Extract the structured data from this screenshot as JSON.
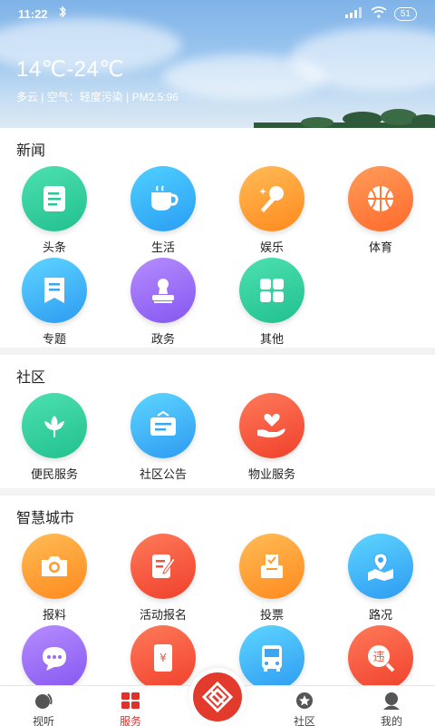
{
  "status": {
    "time": "11:22",
    "battery": "51"
  },
  "weather": {
    "temp": "14℃-24℃",
    "line": "多云 | 空气：轻度污染 | PM2.5:96"
  },
  "sections": {
    "news": {
      "title": "新闻",
      "items": [
        {
          "label": "头条",
          "icon": "document-icon",
          "color_from": "#4de0b0",
          "color_to": "#22c08f"
        },
        {
          "label": "生活",
          "icon": "coffee-cup-icon",
          "color_from": "#4fd0ff",
          "color_to": "#2a9ef4"
        },
        {
          "label": "娱乐",
          "icon": "microphone-icon",
          "color_from": "#ffbb55",
          "color_to": "#ff8a1e"
        },
        {
          "label": "体育",
          "icon": "basketball-icon",
          "color_from": "#ff9c5a",
          "color_to": "#ff6a2b"
        },
        {
          "label": "专题",
          "icon": "bookmark-doc-icon",
          "color_from": "#5ed5ff",
          "color_to": "#2d9bf2"
        },
        {
          "label": "政务",
          "icon": "stamp-icon",
          "color_from": "#b68cff",
          "color_to": "#8557f0"
        },
        {
          "label": "其他",
          "icon": "grid-apps-icon",
          "color_from": "#4de0b0",
          "color_to": "#22c08f"
        }
      ]
    },
    "community": {
      "title": "社区",
      "items": [
        {
          "label": "便民服务",
          "icon": "lotus-icon",
          "color_from": "#4de0b0",
          "color_to": "#22c08f"
        },
        {
          "label": "社区公告",
          "icon": "notice-board-icon",
          "color_from": "#5ed5ff",
          "color_to": "#2d9bf2"
        },
        {
          "label": "物业服务",
          "icon": "heart-hand-icon",
          "color_from": "#ff7a5a",
          "color_to": "#f0402b"
        }
      ]
    },
    "smart_city": {
      "title": "智慧城市",
      "items": [
        {
          "label": "报料",
          "icon": "camera-icon",
          "color_from": "#ffbb55",
          "color_to": "#ff8a1e"
        },
        {
          "label": "活动报名",
          "icon": "edit-form-icon",
          "color_from": "#ff7a5a",
          "color_to": "#f0402b"
        },
        {
          "label": "投票",
          "icon": "ballot-box-icon",
          "color_from": "#ffbb55",
          "color_to": "#ff8a1e"
        },
        {
          "label": "路况",
          "icon": "map-pin-icon",
          "color_from": "#5ed5ff",
          "color_to": "#2d9bf2"
        },
        {
          "label": "",
          "icon": "chat-bubble-icon",
          "color_from": "#b68cff",
          "color_to": "#8557f0"
        },
        {
          "label": "",
          "icon": "phone-yuan-icon",
          "color_from": "#ff7a5a",
          "color_to": "#f0402b"
        },
        {
          "label": "",
          "icon": "bus-icon",
          "color_from": "#5ed5ff",
          "color_to": "#2d9bf2"
        },
        {
          "label": "",
          "icon": "violation-icon",
          "color_from": "#ff7a5a",
          "color_to": "#f0402b"
        }
      ]
    }
  },
  "nav": {
    "items": [
      {
        "label": "视听",
        "icon": "audio-visual-icon",
        "active": false
      },
      {
        "label": "服务",
        "icon": "services-grid-icon",
        "active": true
      },
      {
        "label": "社区",
        "icon": "star-circle-icon",
        "active": false
      },
      {
        "label": "我的",
        "icon": "profile-icon",
        "active": false
      }
    ],
    "accent": "#e0322b"
  }
}
